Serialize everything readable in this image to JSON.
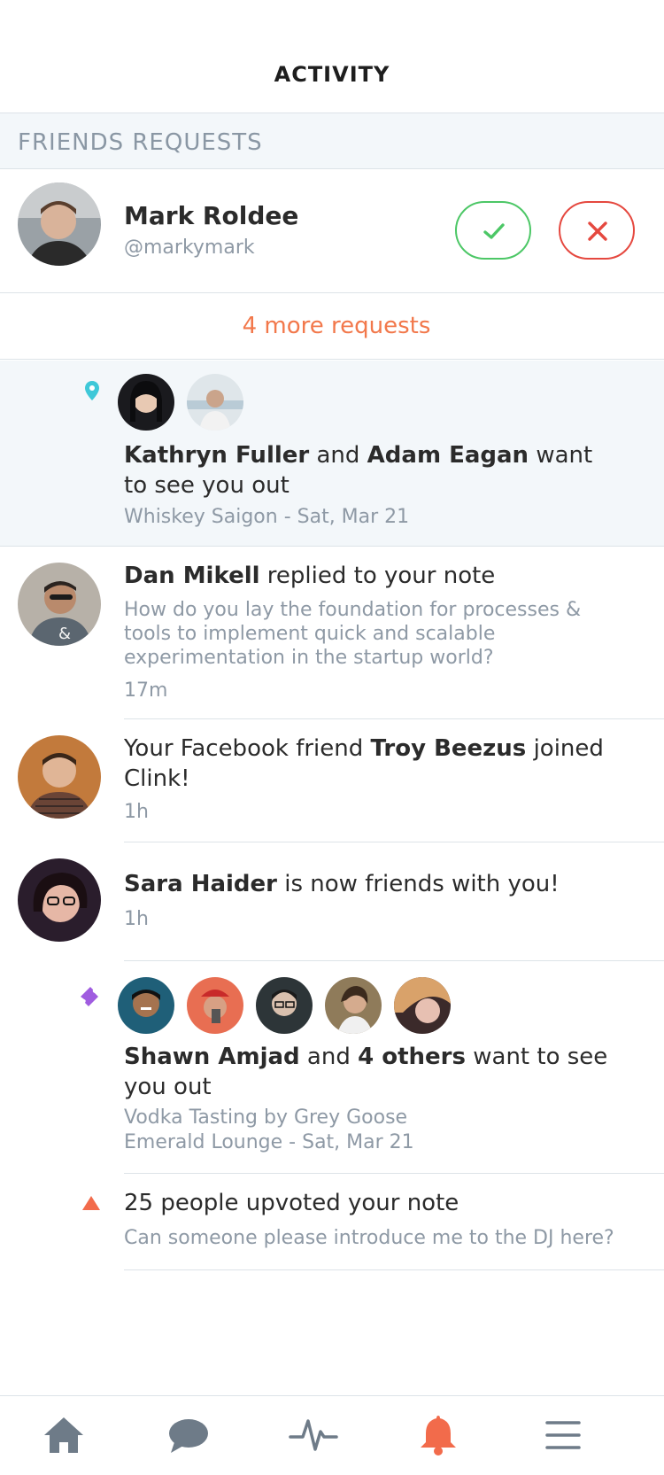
{
  "header": {
    "title": "ACTIVITY"
  },
  "friend_requests": {
    "section_title": "FRIENDS REQUESTS",
    "request": {
      "name": "Mark Roldee",
      "handle": "@markymark"
    },
    "more_label": "4 more requests"
  },
  "feed": [
    {
      "type": "meetup",
      "marker_icon": "location-pin-icon",
      "names": [
        "Kathryn Fuller",
        "Adam Eagan"
      ],
      "connector": "and",
      "action": "want to see you out",
      "detail": "Whiskey Saigon - Sat, Mar 21"
    },
    {
      "type": "reply",
      "name": "Dan Mikell",
      "action": "replied to your note",
      "note": "How do you lay the foundation for processes & tools to implement quick and scalable experimentation in the startup world?",
      "time": "17m"
    },
    {
      "type": "joined",
      "prefix": "Your Facebook friend",
      "name": "Troy Beezus",
      "action": "joined Clink!",
      "time": "1h"
    },
    {
      "type": "friends",
      "name": "Sara Haider",
      "action": "is now friends with you!",
      "time": "1h"
    },
    {
      "type": "event",
      "marker_icon": "ticket-icon",
      "name": "Shawn Amjad",
      "connector": "and",
      "others": "4 others",
      "action": "want to see you out",
      "detail_line1": "Vodka Tasting by Grey Goose",
      "detail_line2": "Emerald Lounge - Sat, Mar 21"
    },
    {
      "type": "upvote",
      "marker_icon": "upvote-triangle-icon",
      "text": "25 people upvoted your note",
      "note": "Can someone please introduce me to the DJ here?"
    }
  ],
  "tabbar": {
    "items": [
      "home-icon",
      "chat-bubble-icon",
      "activity-pulse-icon",
      "bell-icon",
      "menu-icon"
    ],
    "active": "bell-icon"
  },
  "colors": {
    "accent": "#f2784b",
    "accept": "#4cc766",
    "reject": "#e5483f",
    "pin": "#3ec8d8",
    "ticket": "#a05ce0",
    "upvote": "#f26b4b",
    "highlight_bg": "#f3f7fa",
    "muted_text": "#8e99a5"
  }
}
